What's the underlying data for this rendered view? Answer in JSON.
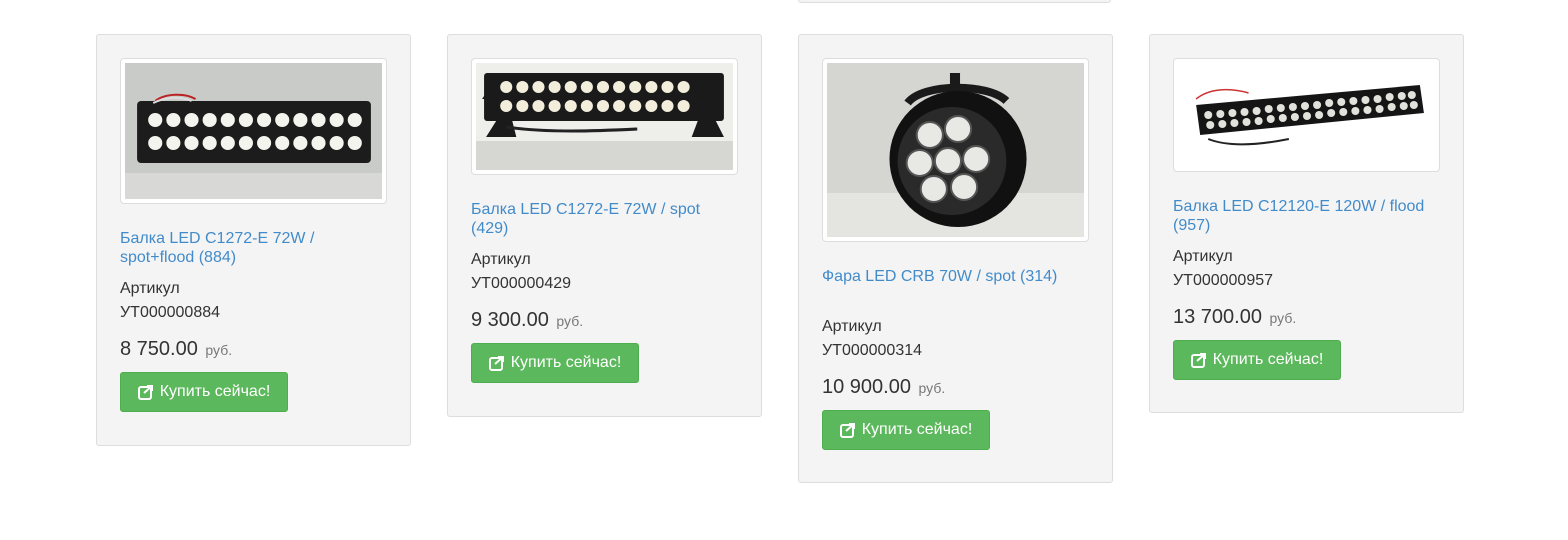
{
  "products": [
    {
      "title": "Балка LED C1272-E 72W / spot+flood (884)",
      "sku_label": "Артикул",
      "sku": "УТ000000884",
      "price": "8 750.00",
      "currency": "руб.",
      "buy_label": "Купить сейчас!",
      "image_icon": "led-light-bar-photo"
    },
    {
      "title": "Балка LED C1272-E 72W / spot (429)",
      "sku_label": "Артикул",
      "sku": "УТ000000429",
      "price": "9 300.00",
      "currency": "руб.",
      "buy_label": "Купить сейчас!",
      "image_icon": "led-light-bar-photo"
    },
    {
      "title": "Фара LED CRB 70W / spot (314)",
      "sku_label": "Артикул",
      "sku": "УТ000000314",
      "price": "10 900.00",
      "currency": "руб.",
      "buy_label": "Купить сейчас!",
      "image_icon": "round-led-headlight-photo"
    },
    {
      "title": "Балка LED C12120-E 120W / flood (957)",
      "sku_label": "Артикул",
      "sku": "УТ000000957",
      "price": "13 700.00",
      "currency": "руб.",
      "buy_label": "Купить сейчас!",
      "image_icon": "long-led-light-bar-photo"
    }
  ],
  "colors": {
    "link": "#428bca",
    "button": "#5cb85c",
    "card_bg": "#f4f4f4",
    "border": "#dddddd"
  },
  "button_icon": "share-arrow-icon"
}
